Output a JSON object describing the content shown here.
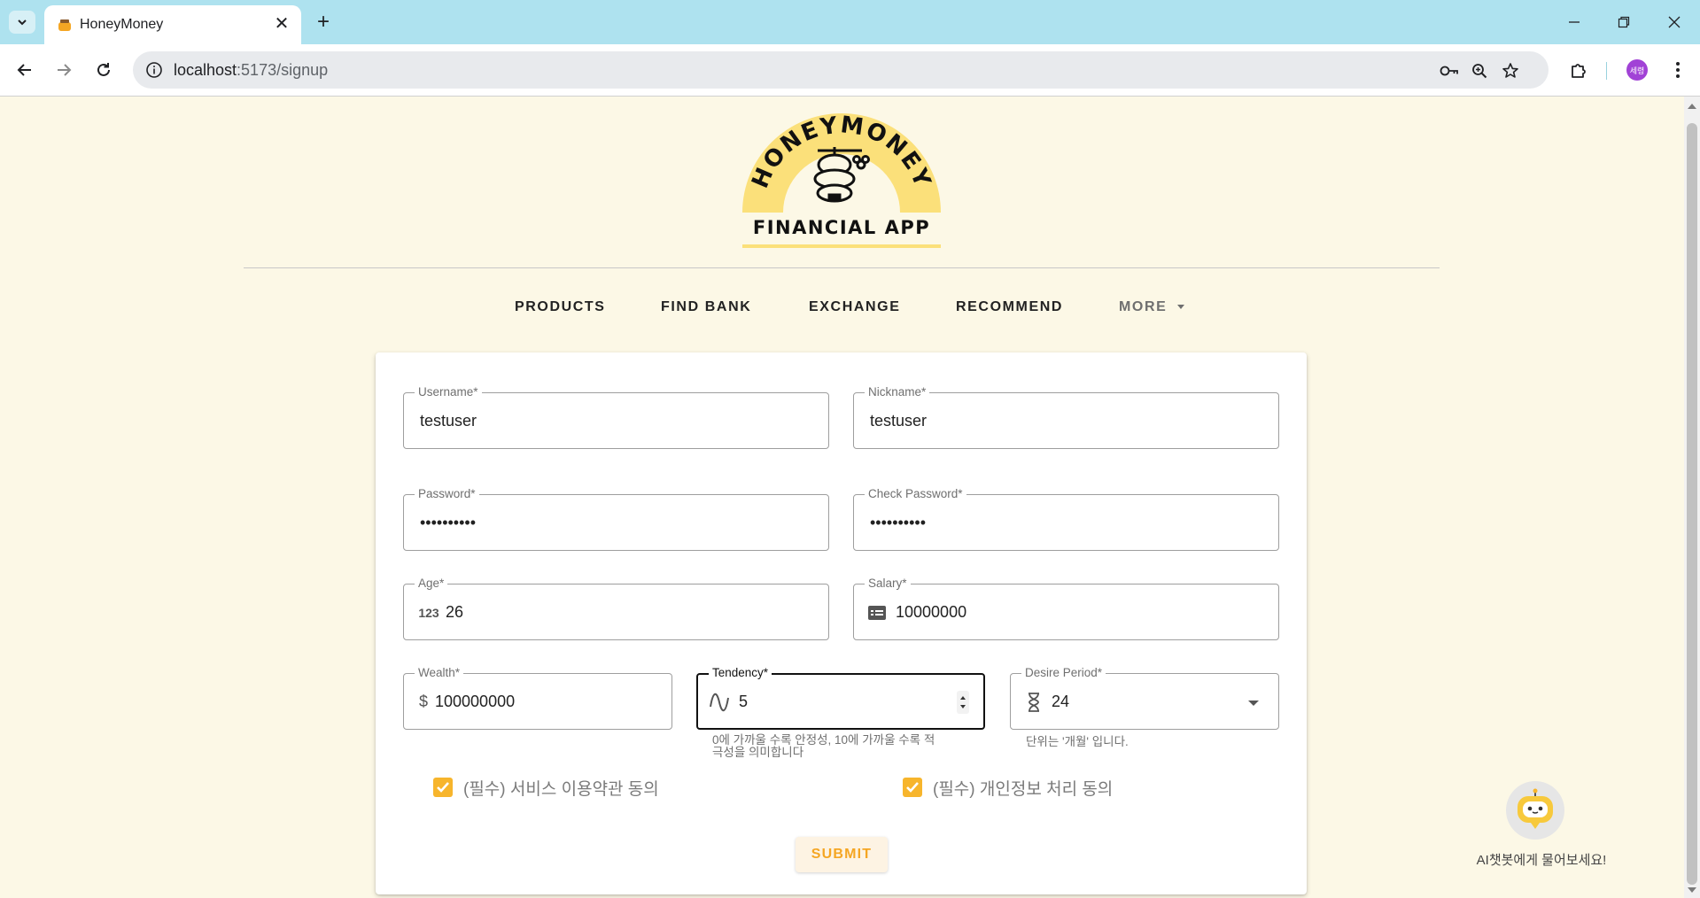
{
  "browser": {
    "tab_title": "HoneyMoney",
    "url_host": "localhost",
    "url_rest": ":5173/signup",
    "profile_initials": "세령"
  },
  "logo": {
    "arc_text": "HONEYMONEY",
    "subtitle": "FINANCIAL APP"
  },
  "nav": {
    "items": [
      "PRODUCTS",
      "FIND BANK",
      "EXCHANGE",
      "RECOMMEND"
    ],
    "more_label": "MORE"
  },
  "form": {
    "username": {
      "label": "Username*",
      "value": "testuser"
    },
    "nickname": {
      "label": "Nickname*",
      "value": "testuser"
    },
    "password": {
      "label": "Password*",
      "value": "••••••••••"
    },
    "check_password": {
      "label": "Check Password*",
      "value": "••••••••••"
    },
    "age": {
      "label": "Age*",
      "value": "26",
      "icon": "numbers-123-icon"
    },
    "salary": {
      "label": "Salary*",
      "value": "10000000",
      "icon": "card-icon"
    },
    "wealth": {
      "label": "Wealth*",
      "value": "100000000",
      "prefix": "$"
    },
    "tendency": {
      "label": "Tendency*",
      "value": "5",
      "hint": "0에 가까울 수록 안정성, 10에 가까울 수록 적극성을 의미합니다",
      "hint_line1": "0에 가까울 수록 안정성, 10에 가까울 수록 적",
      "hint_line2": "극성을 의미합니다"
    },
    "desire_period": {
      "label": "Desire Period*",
      "value": "24",
      "hint": "단위는 '개월' 입니다."
    },
    "agree_terms": {
      "label": "(필수) 서비스 이용약관 동의",
      "checked": true
    },
    "agree_privacy": {
      "label": "(필수) 개인정보 처리 동의",
      "checked": true
    },
    "submit_label": "SUBMIT"
  },
  "chatbot": {
    "label": "AI챗봇에게 물어보세요!"
  },
  "colors": {
    "accent": "#f7b52c",
    "page_bg": "#fcf8e6",
    "tabbar": "#aee2ef"
  }
}
